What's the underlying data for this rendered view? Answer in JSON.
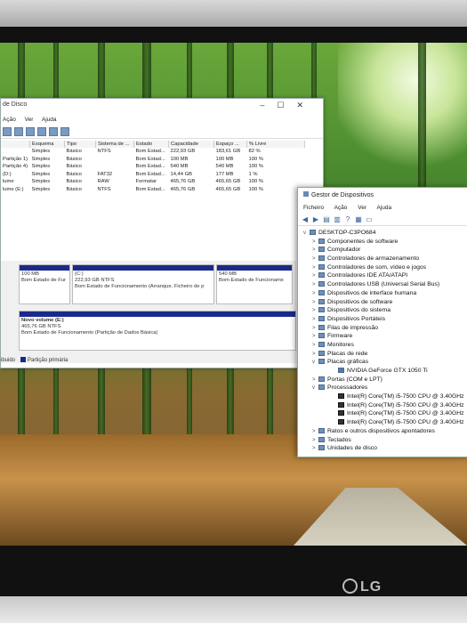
{
  "disk_mgmt": {
    "title": "de Disco",
    "menu": [
      "Ação",
      "Ver",
      "Ajuda"
    ],
    "columns": [
      "",
      "Esquema",
      "Tipo",
      "Sistema de ...",
      "Estado",
      "Capacidade",
      "Espaço ...",
      "% Livre"
    ],
    "rows": [
      [
        "",
        "Simples",
        "Básico",
        "NTFS",
        "Bom Estad...",
        "222,93 GB",
        "183,61 GB",
        "82 %"
      ],
      [
        "Partição 1)",
        "Simples",
        "Básico",
        "",
        "Bom Estad...",
        "100 MB",
        "100 MB",
        "100 %"
      ],
      [
        "Partição 4)",
        "Simples",
        "Básico",
        "",
        "Bom Estad...",
        "540 MB",
        "540 MB",
        "100 %"
      ],
      [
        "(D:)",
        "Simples",
        "Básico",
        "FAT32",
        "Bom Estad...",
        "14,44 GB",
        "177 MB",
        "1 %"
      ],
      [
        "lume",
        "Simples",
        "Básico",
        "RAW",
        "Formatar",
        "465,76 GB",
        "465,65 GB",
        "100 %"
      ],
      [
        "lume (E:)",
        "Simples",
        "Básico",
        "NTFS",
        "Bom Estad...",
        "465,76 GB",
        "465,65 GB",
        "100 %"
      ]
    ],
    "disk0": [
      {
        "size": "100 MB",
        "status": "Bom Estado de Fur"
      },
      {
        "name": "(C:)",
        "size": "222,93 GB NTFS",
        "status": "Bom Estado de Funcionamento (Arranque, Ficheiro de p"
      },
      {
        "size": "540 MB",
        "status": "Bom Estado de Funcionamx"
      }
    ],
    "disk1": {
      "name": "Novo volume (E:)",
      "size": "465,76 GB NTFS",
      "status": "Bom Estado de Funcionamento (Partição de Dados Básica)"
    },
    "legend": [
      "ibuido",
      "Partição primária"
    ]
  },
  "device_mgr": {
    "title": "Gestor de Dispositivos",
    "menu": [
      "Ficheiro",
      "Ação",
      "Ver",
      "Ajuda"
    ],
    "root": "DESKTOP-C3PO684",
    "items": [
      {
        "label": "Componentes de software",
        "exp": ">",
        "icon": "component-icon"
      },
      {
        "label": "Computador",
        "exp": ">",
        "icon": "computer-icon"
      },
      {
        "label": "Controladores de armazenamento",
        "exp": ">",
        "icon": "storage-icon"
      },
      {
        "label": "Controladores de som, vídeo e jogos",
        "exp": ">",
        "icon": "sound-icon"
      },
      {
        "label": "Controladores IDE ATA/ATAPI",
        "exp": ">",
        "icon": "ide-icon"
      },
      {
        "label": "Controladores USB (Universal Serial Bus)",
        "exp": ">",
        "icon": "usb-icon"
      },
      {
        "label": "Dispositivos de interface humana",
        "exp": ">",
        "icon": "hid-icon"
      },
      {
        "label": "Dispositivos de software",
        "exp": ">",
        "icon": "software-device-icon"
      },
      {
        "label": "Dispositivos do sistema",
        "exp": ">",
        "icon": "system-device-icon"
      },
      {
        "label": "Dispositivos Portáteis",
        "exp": ">",
        "icon": "portable-icon"
      },
      {
        "label": "Filas de impressão",
        "exp": ">",
        "icon": "printer-icon"
      },
      {
        "label": "Firmware",
        "exp": ">",
        "icon": "firmware-icon"
      },
      {
        "label": "Monitores",
        "exp": ">",
        "icon": "monitor-icon"
      },
      {
        "label": "Placas de rede",
        "exp": ">",
        "icon": "network-icon"
      },
      {
        "label": "Placas gráficas",
        "exp": "v",
        "icon": "display-adapter-icon"
      },
      {
        "label": "NVIDIA GeForce GTX 1050 Ti",
        "exp": "",
        "icon": "gpu-icon",
        "child": true
      },
      {
        "label": "Portas (COM e LPT)",
        "exp": ">",
        "icon": "port-icon"
      },
      {
        "label": "Processadores",
        "exp": "v",
        "icon": "processor-icon"
      },
      {
        "label": "Intel(R) Core(TM) i5-7500 CPU @ 3.40GHz",
        "exp": "",
        "icon": "cpu-icon",
        "child": true
      },
      {
        "label": "Intel(R) Core(TM) i5-7500 CPU @ 3.40GHz",
        "exp": "",
        "icon": "cpu-icon",
        "child": true
      },
      {
        "label": "Intel(R) Core(TM) i5-7500 CPU @ 3.40GHz",
        "exp": "",
        "icon": "cpu-icon",
        "child": true
      },
      {
        "label": "Intel(R) Core(TM) i5-7500 CPU @ 3.40GHz",
        "exp": "",
        "icon": "cpu-icon",
        "child": true
      },
      {
        "label": "Ratos e outros dispositivos apontadores",
        "exp": ">",
        "icon": "mouse-icon"
      },
      {
        "label": "Teclados",
        "exp": ">",
        "icon": "keyboard-icon"
      },
      {
        "label": "Unidades de disco",
        "exp": ">",
        "icon": "disk-drive-icon"
      }
    ]
  },
  "monitor_brand": "LG"
}
